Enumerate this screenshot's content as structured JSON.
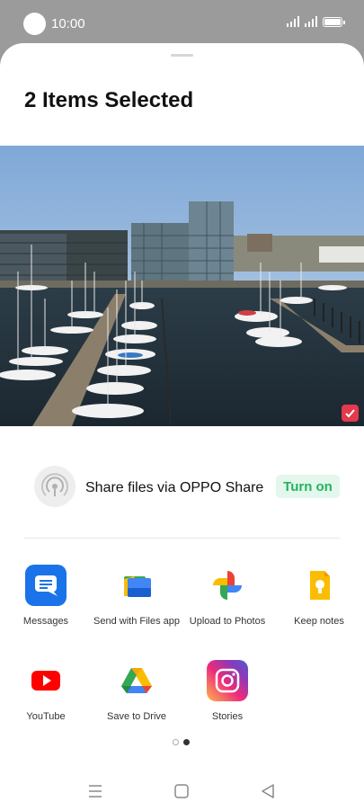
{
  "status_bar": {
    "time": "10:00"
  },
  "sheet": {
    "title": "2 Items Selected"
  },
  "oppo_share": {
    "label": "Share files via OPPO Share",
    "button": "Turn on"
  },
  "apps": [
    {
      "label": "Messages",
      "icon": "messages-icon"
    },
    {
      "label": "Send with Files app",
      "icon": "files-icon"
    },
    {
      "label": "Upload to Photos",
      "icon": "photos-icon"
    },
    {
      "label": "Keep notes",
      "icon": "keep-icon"
    },
    {
      "label": "YouTube",
      "icon": "youtube-icon"
    },
    {
      "label": "Save to Drive",
      "icon": "drive-icon"
    },
    {
      "label": "Stories",
      "icon": "instagram-icon"
    }
  ],
  "pager": {
    "pages": 2,
    "current": 2
  },
  "colors": {
    "accent_green": "#22b45e",
    "check_red": "#e5394c"
  }
}
